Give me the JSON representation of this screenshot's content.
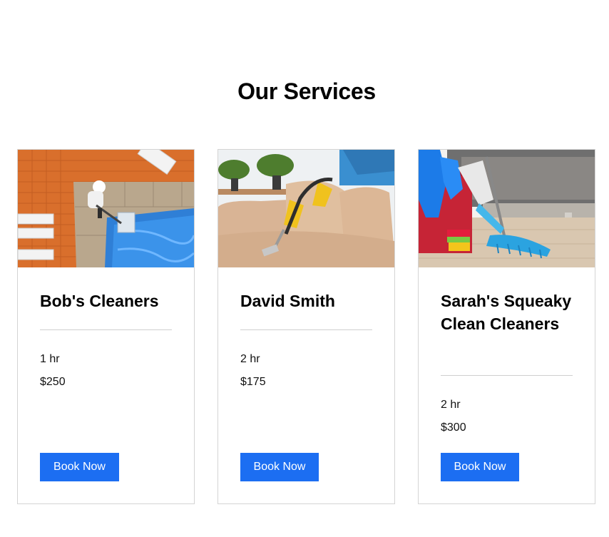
{
  "section": {
    "title": "Our Services"
  },
  "services": [
    {
      "name": "Bob's Cleaners",
      "duration": "1 hr",
      "price": "$250",
      "button": "Book Now",
      "image": "pool-cleaning-photo"
    },
    {
      "name": "David Smith",
      "duration": "2 hr",
      "price": "$175",
      "button": "Book Now",
      "image": "sofa-vacuuming-photo"
    },
    {
      "name": "Sarah's Squeaky Clean Cleaners",
      "duration": "2 hr",
      "price": "$300",
      "button": "Book Now",
      "image": "cleaning-supplies-photo"
    }
  ],
  "colors": {
    "accent": "#1c6ef2",
    "card_border": "#d4d4d4",
    "divider": "#cfcfcf"
  }
}
